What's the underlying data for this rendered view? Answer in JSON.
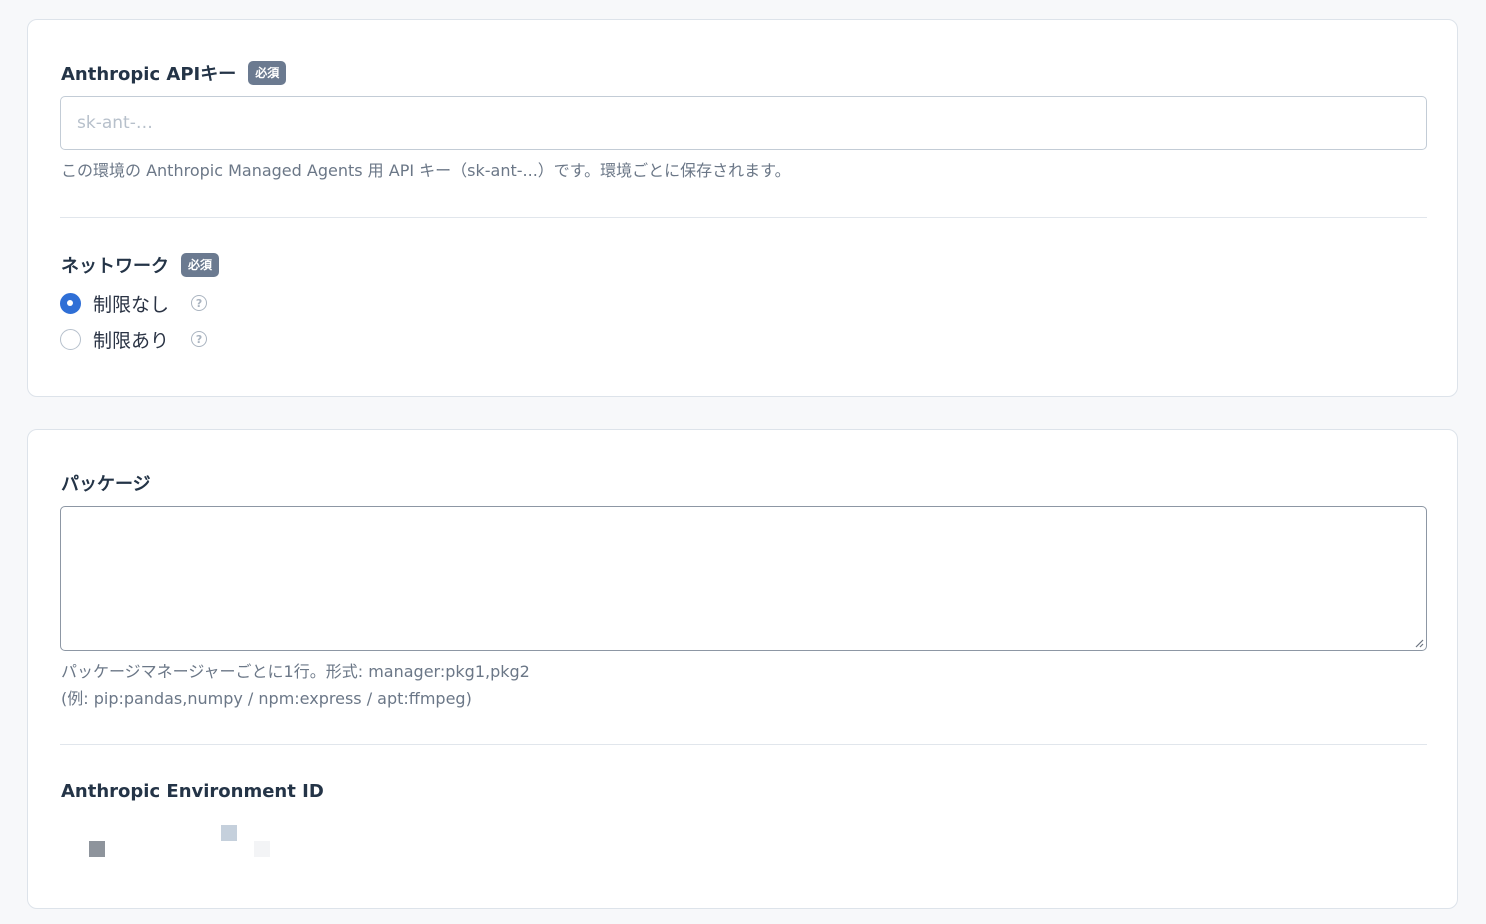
{
  "api_key_section": {
    "label": "Anthropic APIキー",
    "required_badge": "必須",
    "input_placeholder": "sk-ant-…",
    "input_value": "",
    "help_text": "この環境の Anthropic Managed Agents 用 API キー（sk-ant-...）です。環境ごとに保存されます。"
  },
  "network_section": {
    "label": "ネットワーク",
    "required_badge": "必須",
    "options": [
      {
        "label": "制限なし",
        "checked": true,
        "help_icon": "question-circle-icon"
      },
      {
        "label": "制限あり",
        "checked": false,
        "help_icon": "question-circle-icon"
      }
    ]
  },
  "packages_section": {
    "label": "パッケージ",
    "textarea_value": "",
    "help_line1": "パッケージマネージャーごとに1行。形式: manager:pkg1,pkg2",
    "help_line2": "(例: pip:pandas,numpy / npm:express / apt:ffmpeg)"
  },
  "environment_id_section": {
    "label": "Anthropic Environment ID",
    "loading_indicator": "loading-squares",
    "colors": {
      "dark": "#8e949c",
      "light": "#c5d0dc",
      "faint": "#f3f4f6"
    }
  },
  "colors": {
    "accent": "#2f6fd6",
    "badge_bg": "#6b7a90",
    "page_bg": "#f7f8fa",
    "card_border": "#dde3ea"
  }
}
